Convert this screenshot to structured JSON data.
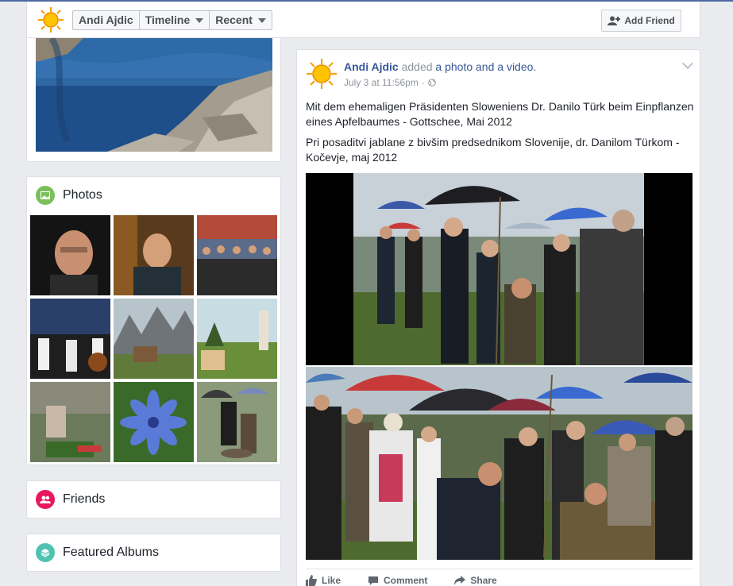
{
  "profile": {
    "name": "Andi Ajdic"
  },
  "nav": {
    "items": [
      "Andi Ajdic",
      "Timeline",
      "Recent"
    ]
  },
  "add_friend_label": "Add Friend",
  "photos": {
    "title": "Photos"
  },
  "friends": {
    "title": "Friends"
  },
  "featured_albums": {
    "title": "Featured Albums"
  },
  "post": {
    "author": "Andi Ajdic",
    "action_prefix": "added",
    "action_link": "a photo and a video.",
    "timestamp": "July 3 at 11:56pm",
    "text_de": "Mit dem ehemaligen Präsidenten Sloweniens Dr. Danilo Türk beim Einpflanzen eines Apfelbaumes - Gottschee, Mai 2012",
    "text_sl": "Pri posaditvi jablane z bivšim predsednikom Slovenije, dr. Danilom Türkom - Kočevje, maj 2012"
  },
  "actions": {
    "like": "Like",
    "comment": "Comment",
    "share": "Share"
  },
  "colors": {
    "link": "#365899",
    "photos_icon": "#7ac05a",
    "friends_icon": "#e9175f",
    "albums_icon": "#50c2b1"
  }
}
